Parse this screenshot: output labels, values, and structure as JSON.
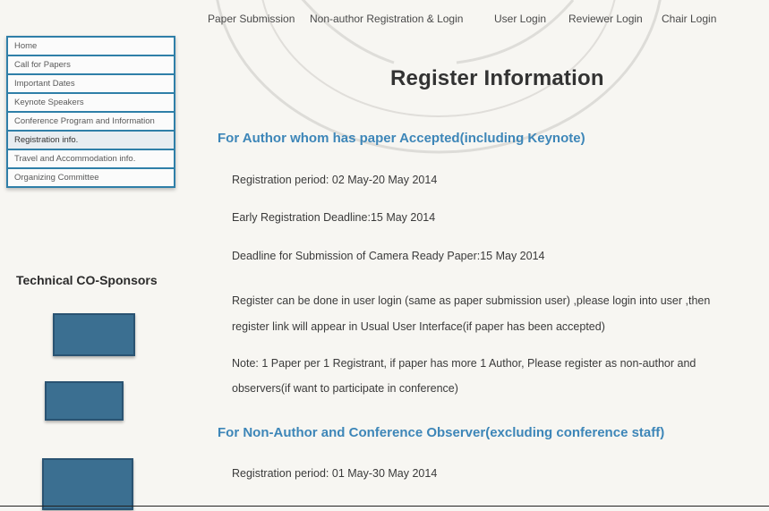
{
  "nav": {
    "items": [
      "Paper Submission",
      "Non-author Registration & Login",
      "User Login",
      "Reviewer Login",
      "Chair Login"
    ]
  },
  "sidebar": {
    "items": [
      "Home",
      "Call for Papers",
      "Important Dates",
      "Keynote Speakers",
      "Conference Program and Information",
      "Registration info.",
      "Travel and Accommodation info.",
      "Organizing Committee"
    ],
    "active_index": 5
  },
  "sponsors": {
    "title": "Technical CO-Sponsors"
  },
  "main": {
    "title": "Register Information",
    "author_section": {
      "heading": "For Author whom has paper Accepted(including Keynote)",
      "registration_period": "Registration period: 02 May-20 May 2014",
      "early_deadline": "Early Registration Deadline:15 May 2014",
      "camera_ready_deadline": "Deadline for Submission of Camera Ready Paper:15 May 2014",
      "register_note_line1": "Register can be done in user login (same as paper submission user) ,please login into user ,then",
      "register_note_line2": "register link will appear in Usual User Interface(if paper has been accepted)",
      "note_line1": "Note: 1 Paper per 1 Registrant, if paper has more 1 Author, Please register as non-author and",
      "note_line2": "observers(if want to participate in conference)"
    },
    "nonauthor_section": {
      "heading": "For Non-Author and Conference Observer(excluding conference staff)",
      "registration_period": "Registration period: 01 May-30 May 2014"
    }
  },
  "colors": {
    "sidebar_border": "#2f7fa8",
    "section_heading": "#3d86b8",
    "logo_fill": "#3b6f91"
  }
}
